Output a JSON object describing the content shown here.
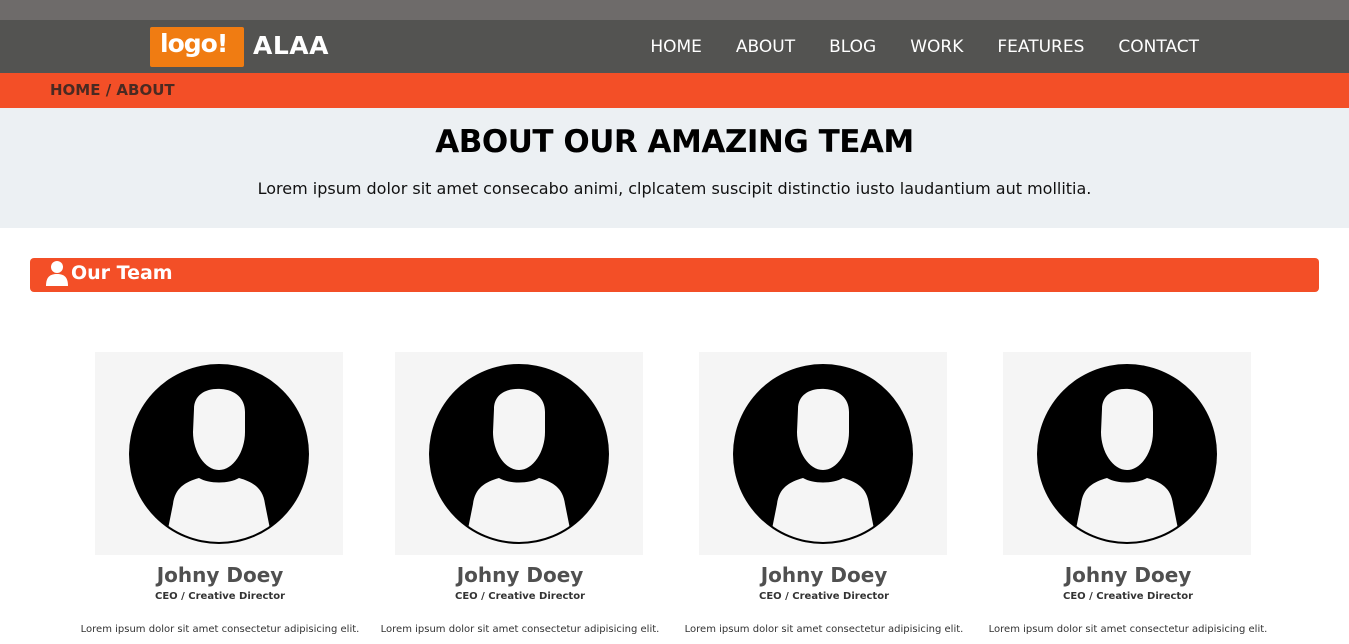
{
  "header": {
    "logo_text": "logo!",
    "brand": "ALAA",
    "nav": [
      "HOME",
      "ABOUT",
      "BLOG",
      "WORK",
      "FEATURES",
      "CONTACT"
    ]
  },
  "breadcrumb": "HOME / ABOUT",
  "hero": {
    "title": "ABOUT OUR AMAZING TEAM",
    "subtitle": "Lorem ipsum dolor sit amet consecabo animi, clplcatem suscipit distinctio iusto laudantium aut mollitia."
  },
  "team_section": {
    "icon": "user-icon",
    "label": "Our Team"
  },
  "members": [
    {
      "name": "Johny Doey",
      "role": "CEO / Creative Director",
      "bio": "Lorem ipsum dolor sit amet consectetur adipisicing elit."
    },
    {
      "name": "Johny Doey",
      "role": "CEO / Creative Director",
      "bio": "Lorem ipsum dolor sit amet consectetur adipisicing elit."
    },
    {
      "name": "Johny Doey",
      "role": "CEO / Creative Director",
      "bio": "Lorem ipsum dolor sit amet consectetur adipisicing elit."
    },
    {
      "name": "Johny Doey",
      "role": "CEO / Creative Director",
      "bio": "Lorem ipsum dolor sit amet consectetur adipisicing elit."
    }
  ],
  "colors": {
    "navbar": "#535351",
    "accent": "#f34f27",
    "logo": "#f07c12",
    "hero_bg": "#ecf0f3"
  }
}
